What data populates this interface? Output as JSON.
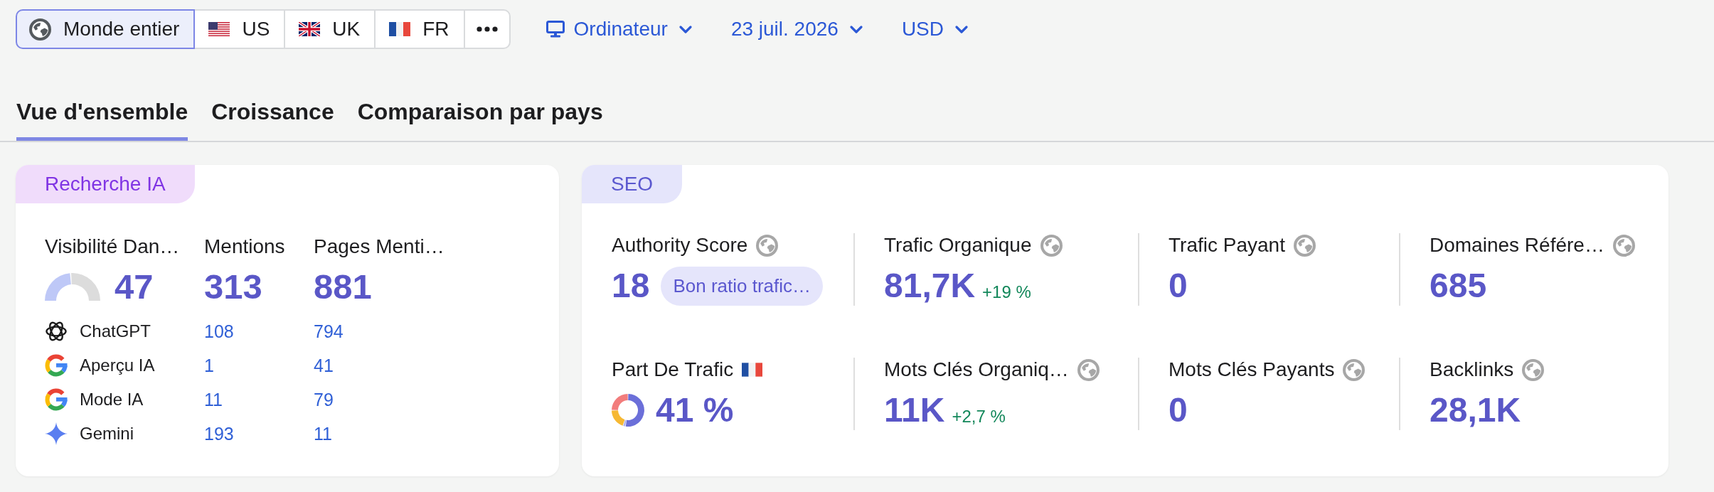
{
  "regions": [
    {
      "label": "Monde entier",
      "kind": "world",
      "selected": true
    },
    {
      "label": "US",
      "kind": "us",
      "selected": false
    },
    {
      "label": "UK",
      "kind": "uk",
      "selected": false
    },
    {
      "label": "FR",
      "kind": "fr",
      "selected": false
    }
  ],
  "filters": [
    {
      "label": "Ordinateur",
      "kind": "device"
    },
    {
      "label": "23 juil. 2026",
      "kind": "date"
    },
    {
      "label": "USD",
      "kind": "currency"
    }
  ],
  "tabs": [
    {
      "label": "Vue d'ensemble",
      "selected": true
    },
    {
      "label": "Croissance",
      "selected": false
    },
    {
      "label": "Comparaison par pays",
      "selected": false
    }
  ],
  "ai_search": {
    "tag": "Recherche IA",
    "columns": [
      {
        "label": "Visibilité Dan…",
        "total": "47",
        "level": 0.47
      },
      {
        "label": "Mentions",
        "total": "313"
      },
      {
        "label": "Pages Menti…",
        "total": "881"
      }
    ],
    "rows": [
      {
        "name": "ChatGPT",
        "kind": "chatgpt",
        "mentions": "108",
        "pages": "794"
      },
      {
        "name": "Aperçu IA",
        "kind": "google",
        "mentions": "1",
        "pages": "41"
      },
      {
        "name": "Mode IA",
        "kind": "google",
        "mentions": "11",
        "pages": "79"
      },
      {
        "name": "Gemini",
        "kind": "gemini",
        "mentions": "193",
        "pages": "11"
      }
    ]
  },
  "seo": {
    "tag": "SEO",
    "metrics": [
      {
        "label": "Authority Score",
        "kind": "number",
        "value": "18",
        "badge": "Bon ratio trafic…"
      },
      {
        "label": "Trafic Organique",
        "kind": "number",
        "value": "81,7K",
        "change": "+19 %"
      },
      {
        "label": "Trafic Payant",
        "kind": "number",
        "value": "0"
      },
      {
        "label": "Domaines Référe…",
        "kind": "number",
        "value": "685"
      },
      {
        "label": "Part De Trafic",
        "kind": "share",
        "value": "41 %"
      },
      {
        "label": "Mots Clés Organiq…",
        "kind": "number",
        "value": "11K",
        "change": "+2,7 %"
      },
      {
        "label": "Mots Clés Payants",
        "kind": "number",
        "value": "0"
      },
      {
        "label": "Backlinks",
        "kind": "number",
        "value": "28,1K"
      }
    ]
  }
}
